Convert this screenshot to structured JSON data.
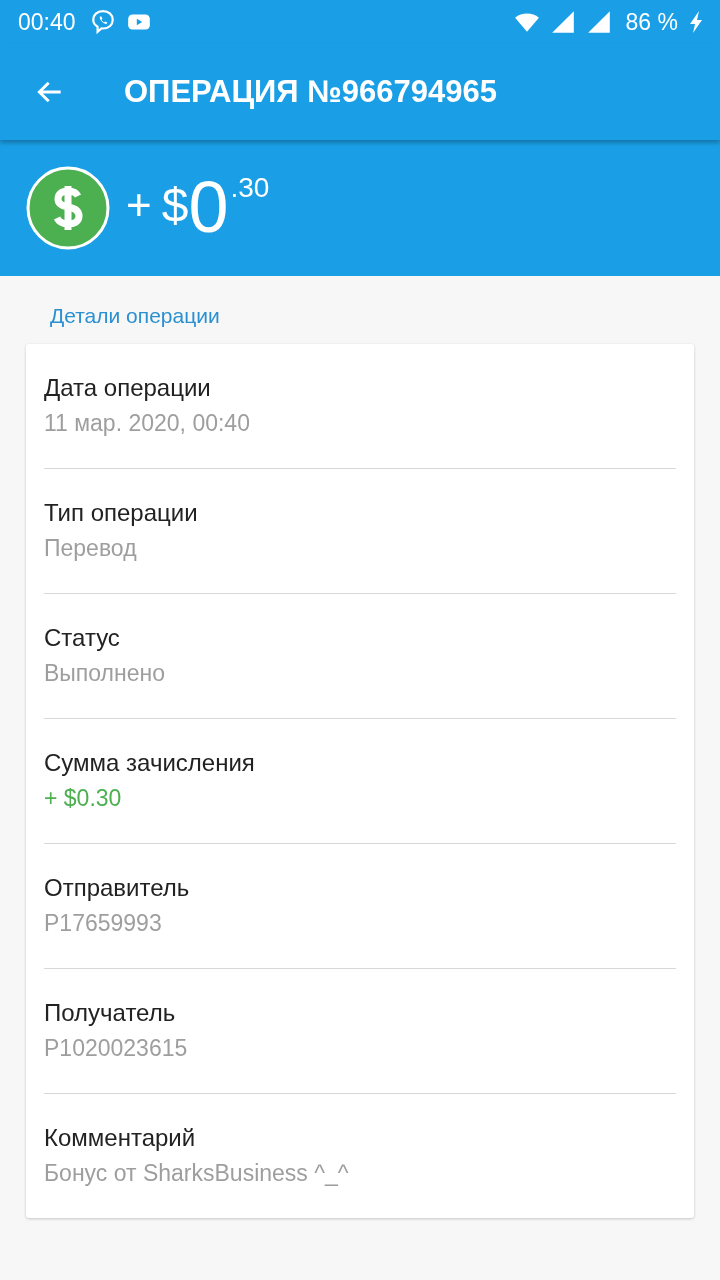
{
  "status_bar": {
    "time": "00:40",
    "battery": "86 %"
  },
  "toolbar": {
    "title": "ОПЕРАЦИЯ №966794965"
  },
  "amount": {
    "sign": "+",
    "currency": "$",
    "whole": "0",
    "cents": ".30"
  },
  "section_title": "Детали операции",
  "details": [
    {
      "label": "Дата операции",
      "value": "11 мар. 2020, 00:40",
      "kind": "plain"
    },
    {
      "label": "Тип операции",
      "value": "Перевод",
      "kind": "plain"
    },
    {
      "label": "Статус",
      "value": "Выполнено",
      "kind": "plain"
    },
    {
      "label": "Сумма зачисления",
      "value": "+ $0.30",
      "kind": "positive"
    },
    {
      "label": "Отправитель",
      "value": "P17659993",
      "kind": "plain"
    },
    {
      "label": "Получатель",
      "value": "P1020023615",
      "kind": "plain"
    },
    {
      "label": "Комментарий",
      "value": "Бонус от SharksBusiness ^_^",
      "kind": "plain"
    }
  ]
}
